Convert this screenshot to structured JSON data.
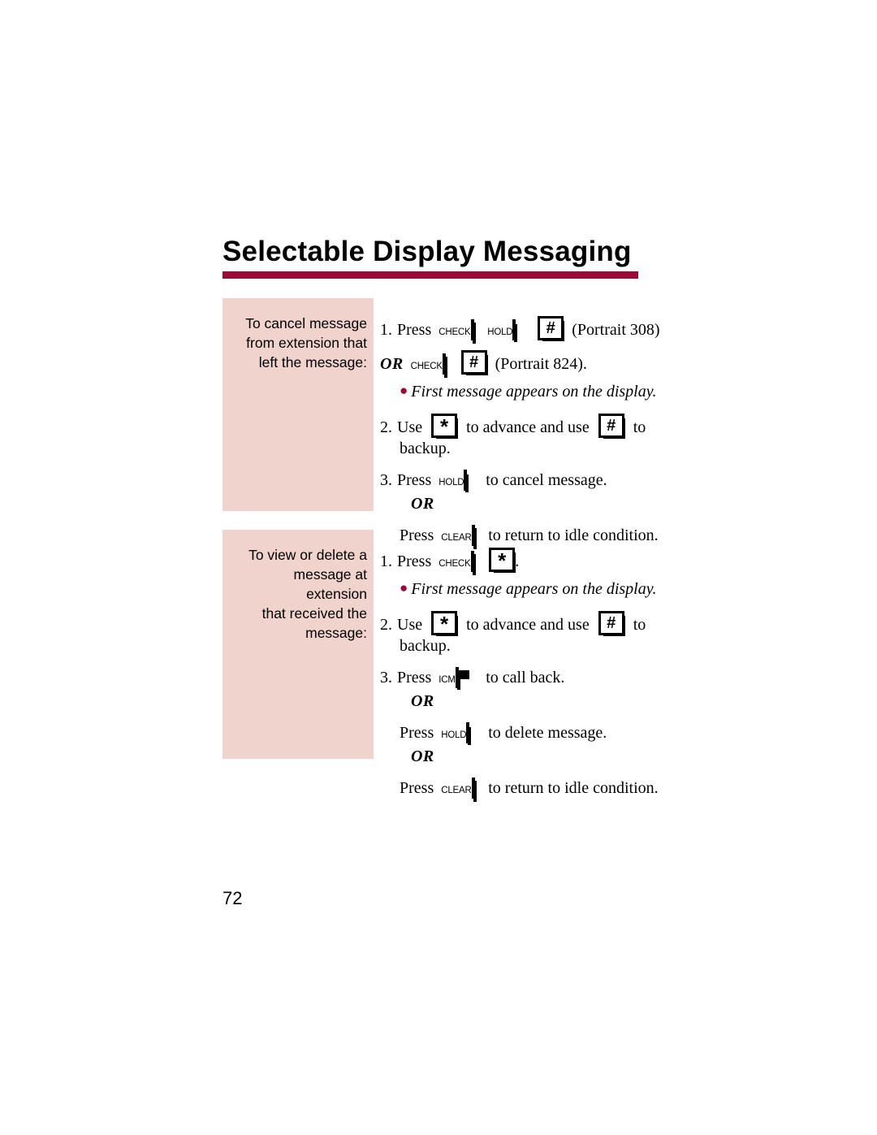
{
  "document": {
    "title": "Selectable Display Messaging",
    "page_number": "72",
    "rule_color": "#9c0b38",
    "label_pane_color": "#efd3cc"
  },
  "sections": [
    {
      "label": "To cancel message from extension that left the message:",
      "label_lines": [
        "To cancel message",
        "from extension that",
        "left the message:"
      ],
      "steps": [
        {
          "number": "1.",
          "verb": "Press",
          "keys": [
            {
              "type": "wide",
              "style": "filled",
              "cap": "CHECK"
            },
            {
              "type": "wide",
              "style": "outline",
              "cap": "HOLD"
            },
            {
              "type": "pad",
              "glyph": "#"
            }
          ],
          "trailing": "(Portrait 308)"
        },
        {
          "or": "OR",
          "keys": [
            {
              "type": "wide",
              "style": "filled",
              "cap": "CHECK"
            },
            {
              "type": "pad",
              "glyph": "#"
            }
          ],
          "trailing": "(Portrait 824)."
        },
        {
          "bullet": "First message appears on the display."
        },
        {
          "number": "2.",
          "verb": "Use",
          "keys": [
            {
              "type": "pad",
              "glyph": "*"
            }
          ],
          "mid": "to advance and use",
          "keys2": [
            {
              "type": "pad",
              "glyph": "#"
            }
          ],
          "tail": "to",
          "wrap": "backup."
        },
        {
          "number": "3.",
          "verb": "Press",
          "keys": [
            {
              "type": "wide",
              "style": "outline",
              "cap": "HOLD"
            }
          ],
          "tail": "to cancel message."
        },
        {
          "or": "OR"
        },
        {
          "verb": "Press",
          "keys": [
            {
              "type": "wide",
              "style": "filled",
              "cap": "CLEAR"
            }
          ],
          "tail": "to return to idle condition."
        }
      ]
    },
    {
      "label": "To view or delete a message at extension that received the message:",
      "label_lines": [
        "To view or delete a",
        "message at extension",
        "that received the",
        "message:"
      ],
      "steps": [
        {
          "number": "1.",
          "verb": "Press",
          "keys": [
            {
              "type": "wide",
              "style": "filled",
              "cap": "CHECK"
            },
            {
              "type": "pad",
              "glyph": "*"
            }
          ],
          "tail": "."
        },
        {
          "bullet": "First message appears on the display."
        },
        {
          "number": "2.",
          "verb": "Use",
          "keys": [
            {
              "type": "pad",
              "glyph": "*"
            }
          ],
          "mid": "to advance and use",
          "keys2": [
            {
              "type": "pad",
              "glyph": "#"
            }
          ],
          "tail": "to",
          "wrap": "backup."
        },
        {
          "number": "3.",
          "verb": "Press",
          "keys": [
            {
              "type": "wide",
              "style": "led",
              "cap": "ICM"
            }
          ],
          "tail": "to call back."
        },
        {
          "or": "OR"
        },
        {
          "verb": "Press",
          "keys": [
            {
              "type": "wide",
              "style": "outline",
              "cap": "HOLD"
            }
          ],
          "tail": "to delete message."
        },
        {
          "or": "OR"
        },
        {
          "verb": "Press",
          "keys": [
            {
              "type": "wide",
              "style": "filled",
              "cap": "CLEAR"
            }
          ],
          "tail": "to return to idle condition."
        }
      ]
    }
  ]
}
